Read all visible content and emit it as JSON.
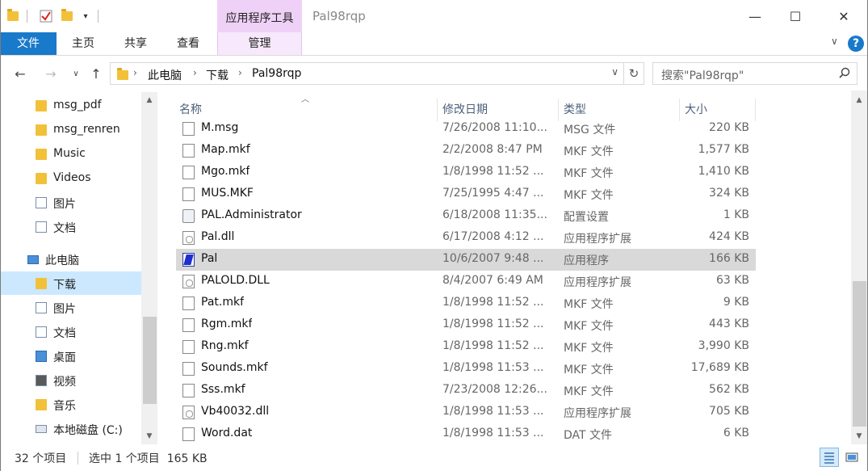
{
  "window": {
    "title": "Pal98rqp",
    "context_tab_title": "应用程序工具",
    "minimize_glyph": "—",
    "maximize_glyph": "☐",
    "close_glyph": "✕"
  },
  "ribbon": {
    "tabs": [
      {
        "label": "文件"
      },
      {
        "label": "主页"
      },
      {
        "label": "共享"
      },
      {
        "label": "查看"
      },
      {
        "label": "管理"
      }
    ],
    "help_glyph": "?",
    "expand_glyph": "∨"
  },
  "address": {
    "crumbs": [
      "此电脑",
      "下载",
      "Pal98rqp"
    ],
    "separator": "›"
  },
  "search": {
    "placeholder": "搜索\"Pal98rqp\""
  },
  "nav_pane": {
    "items": [
      {
        "label": "msg_pdf",
        "icon": "folder-icon"
      },
      {
        "label": "msg_renren",
        "icon": "folder-icon"
      },
      {
        "label": "Music",
        "icon": "folder-icon"
      },
      {
        "label": "Videos",
        "icon": "folder-icon"
      },
      {
        "label": "图片",
        "icon": "pictures-icon"
      },
      {
        "label": "文档",
        "icon": "documents-icon"
      },
      {
        "label": "此电脑",
        "icon": "computer-icon"
      },
      {
        "label": "下载",
        "icon": "downloads-icon",
        "selected": true
      },
      {
        "label": "图片",
        "icon": "pictures-icon"
      },
      {
        "label": "文档",
        "icon": "documents-icon"
      },
      {
        "label": "桌面",
        "icon": "desktop-icon"
      },
      {
        "label": "视频",
        "icon": "videos-icon"
      },
      {
        "label": "音乐",
        "icon": "music-icon"
      },
      {
        "label": "本地磁盘 (C:)",
        "icon": "drive-icon"
      }
    ]
  },
  "file_list": {
    "columns": [
      "名称",
      "修改日期",
      "类型",
      "大小"
    ],
    "rows": [
      {
        "name": "M.msg",
        "date": "7/26/2008 11:10...",
        "type": "MSG 文件",
        "size": "220 KB",
        "icon": "file-icon"
      },
      {
        "name": "Map.mkf",
        "date": "2/2/2008 8:47 PM",
        "type": "MKF 文件",
        "size": "1,577 KB",
        "icon": "file-icon"
      },
      {
        "name": "Mgo.mkf",
        "date": "1/8/1998 11:52 ...",
        "type": "MKF 文件",
        "size": "1,410 KB",
        "icon": "file-icon"
      },
      {
        "name": "MUS.MKF",
        "date": "7/25/1995 4:47 ...",
        "type": "MKF 文件",
        "size": "324 KB",
        "icon": "file-icon"
      },
      {
        "name": "PAL.Administrator",
        "date": "6/18/2008 11:35...",
        "type": "配置设置",
        "size": "1 KB",
        "icon": "settings-file-icon"
      },
      {
        "name": "Pal.dll",
        "date": "6/17/2008 4:12 ...",
        "type": "应用程序扩展",
        "size": "424 KB",
        "icon": "dll-icon"
      },
      {
        "name": "Pal",
        "date": "10/6/2007 9:48 ...",
        "type": "应用程序",
        "size": "166 KB",
        "icon": "application-icon",
        "selected": true
      },
      {
        "name": "PALOLD.DLL",
        "date": "8/4/2007 6:49 AM",
        "type": "应用程序扩展",
        "size": "63 KB",
        "icon": "dll-icon"
      },
      {
        "name": "Pat.mkf",
        "date": "1/8/1998 11:52 ...",
        "type": "MKF 文件",
        "size": "9 KB",
        "icon": "file-icon"
      },
      {
        "name": "Rgm.mkf",
        "date": "1/8/1998 11:52 ...",
        "type": "MKF 文件",
        "size": "443 KB",
        "icon": "file-icon"
      },
      {
        "name": "Rng.mkf",
        "date": "1/8/1998 11:52 ...",
        "type": "MKF 文件",
        "size": "3,990 KB",
        "icon": "file-icon"
      },
      {
        "name": "Sounds.mkf",
        "date": "1/8/1998 11:53 ...",
        "type": "MKF 文件",
        "size": "17,689 KB",
        "icon": "file-icon"
      },
      {
        "name": "Sss.mkf",
        "date": "7/23/2008 12:26...",
        "type": "MKF 文件",
        "size": "562 KB",
        "icon": "file-icon"
      },
      {
        "name": "Vb40032.dll",
        "date": "1/8/1998 11:53 ...",
        "type": "应用程序扩展",
        "size": "705 KB",
        "icon": "dll-icon"
      },
      {
        "name": "Word.dat",
        "date": "1/8/1998 11:53 ...",
        "type": "DAT 文件",
        "size": "6 KB",
        "icon": "file-icon"
      }
    ]
  },
  "status": {
    "item_count": "32 个项目",
    "selection": "选中 1 个项目  165 KB"
  },
  "colors": {
    "file_tab": "#1979ca",
    "context_tab": "#efd1f7",
    "selected_nav": "#cce8ff",
    "selected_row": "#d9d9d9"
  }
}
